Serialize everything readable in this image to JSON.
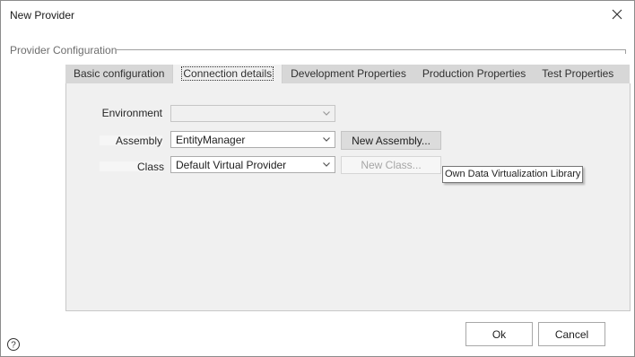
{
  "window": {
    "title": "New Provider"
  },
  "group": {
    "legend": "Provider Configuration"
  },
  "tabs": [
    {
      "label": "Basic configuration",
      "active": false
    },
    {
      "label": "Connection details",
      "active": true
    },
    {
      "label": "Development Properties",
      "active": false
    },
    {
      "label": "Production Properties",
      "active": false
    },
    {
      "label": "Test Properties",
      "active": false
    }
  ],
  "form": {
    "environment_label": "Environment",
    "environment_value": "",
    "assembly_label": "Assembly",
    "assembly_value": "EntityManager",
    "class_label": "Class",
    "class_value": "Default Virtual Provider",
    "new_assembly_label": "New Assembly...",
    "new_class_label": "New Class..."
  },
  "tooltip": {
    "text": "Own Data Virtualization Library"
  },
  "footer": {
    "ok_label": "Ok",
    "cancel_label": "Cancel"
  },
  "icons": {
    "close": "close-icon",
    "help": "help-icon",
    "dropdown": "chevron-down-icon"
  },
  "colors": {
    "tab_strip": "#d7d7d7",
    "panel_background": "#f0f0f0",
    "button_gray": "#dcdcdc"
  }
}
